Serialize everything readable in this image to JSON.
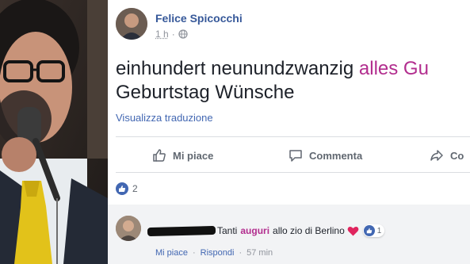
{
  "post": {
    "author": "Felice Spicocchi",
    "time": "1 h",
    "privacy_separator": "·",
    "text_line1_before": "einhundert neunundzwanzig ",
    "text_line1_highlight": "alles Gu",
    "text_line2": "Geburtstag Wünsche",
    "translate_label": "Visualizza traduzione"
  },
  "actions": {
    "like": "Mi piace",
    "comment": "Commenta",
    "share": "Co"
  },
  "reactions": {
    "count": "2"
  },
  "comment": {
    "text_before": "Tanti",
    "highlight": "auguri",
    "text_after": "allo zio di Berlino",
    "like_count": "1",
    "like_label": "Mi piace",
    "separator": "·",
    "reply_label": "Rispondi",
    "time": "57 min"
  },
  "colors": {
    "link_blue": "#365899",
    "highlight_magenta": "#b22d8e",
    "like_blue": "#4267b2"
  }
}
